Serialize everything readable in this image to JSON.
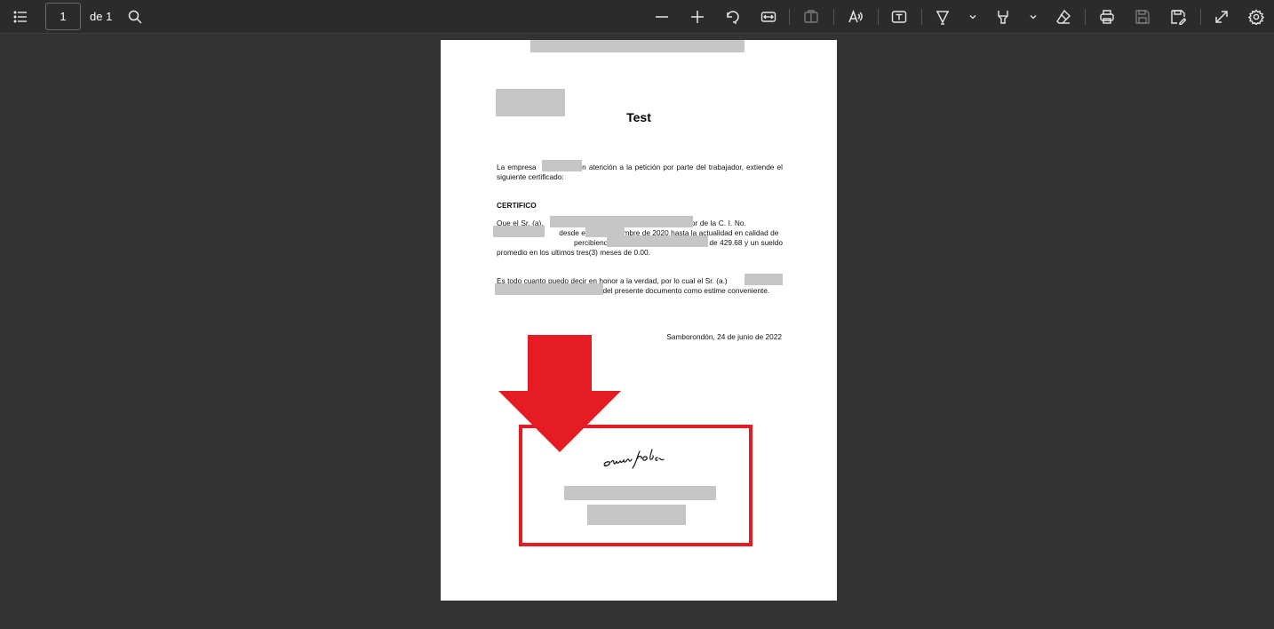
{
  "toolbar": {
    "page_number": "1",
    "page_of": "de 1"
  },
  "document": {
    "title": "Test",
    "para1": "La empresa               en atención a la petición por parte del trabajador, extiende el siguiente certificado:",
    "heading": "CERTIFICO",
    "para2": "Que el Sr. (a).                                                       portador de la C. I. No.                 labora en               desde el 4 de noviembre de 2020 hasta la actualidad en calidad de                                     percibiendo una remuneración promedio de 429.68 y un sueldo promedio en los ultimos tres(3) meses de 0.00.",
    "para3": "Es todo cuanto puedo decir en honor a la verdad, por lo cual el Sr. (a.)                                                   puede hacer uso del presente documento como estime conveniente.",
    "date": "Samborondón, 24 de junio de 2022",
    "signature": "steven jobs"
  },
  "colors": {
    "toolbar_bg": "#2b2b2b",
    "viewer_bg": "#333333",
    "highlight_red": "#e51c23",
    "redaction": "#c6c6c6"
  },
  "icons": [
    "list-icon",
    "search-icon",
    "minus-icon",
    "plus-icon",
    "rotate-icon",
    "fit-width-icon",
    "two-page-icon",
    "read-aloud-icon",
    "text-box-icon",
    "draw-icon",
    "chevron-down-icon",
    "highlight-icon",
    "eraser-icon",
    "print-icon",
    "save-icon",
    "save-as-icon",
    "fullscreen-icon",
    "settings-icon"
  ]
}
